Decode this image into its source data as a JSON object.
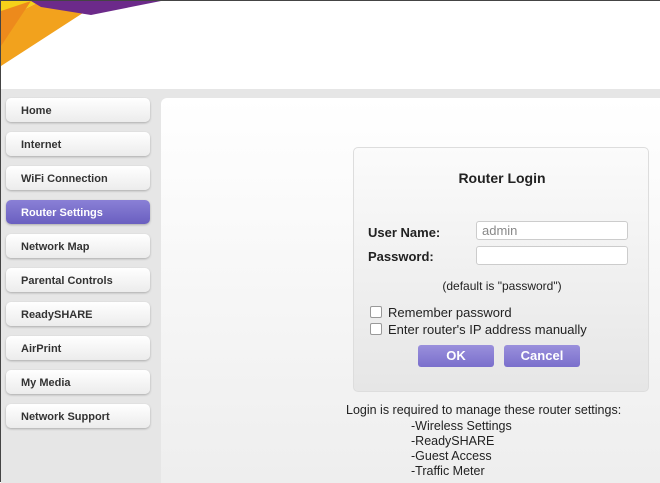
{
  "sidebar": {
    "items": [
      {
        "label": "Home"
      },
      {
        "label": "Internet"
      },
      {
        "label": "WiFi Connection"
      },
      {
        "label": "Router Settings"
      },
      {
        "label": "Network Map"
      },
      {
        "label": "Parental Controls"
      },
      {
        "label": "ReadySHARE"
      },
      {
        "label": "AirPrint"
      },
      {
        "label": "My Media"
      },
      {
        "label": "Network Support"
      }
    ],
    "active": "Router Settings"
  },
  "login": {
    "title": "Router Login",
    "username_label": "User Name:",
    "username_value": "admin",
    "password_label": "Password:",
    "password_value": "",
    "hint": "(default is \"password\")",
    "remember": "Remember password",
    "manual_ip": "Enter router's IP address manually",
    "ok": "OK",
    "cancel": "Cancel"
  },
  "info": {
    "text": "Login is required to manage these router settings:",
    "items": [
      "-Wireless Settings",
      "-ReadySHARE",
      "-Guest Access",
      "-Traffic Meter"
    ]
  },
  "colors": {
    "accent": "#7a6fcc"
  }
}
